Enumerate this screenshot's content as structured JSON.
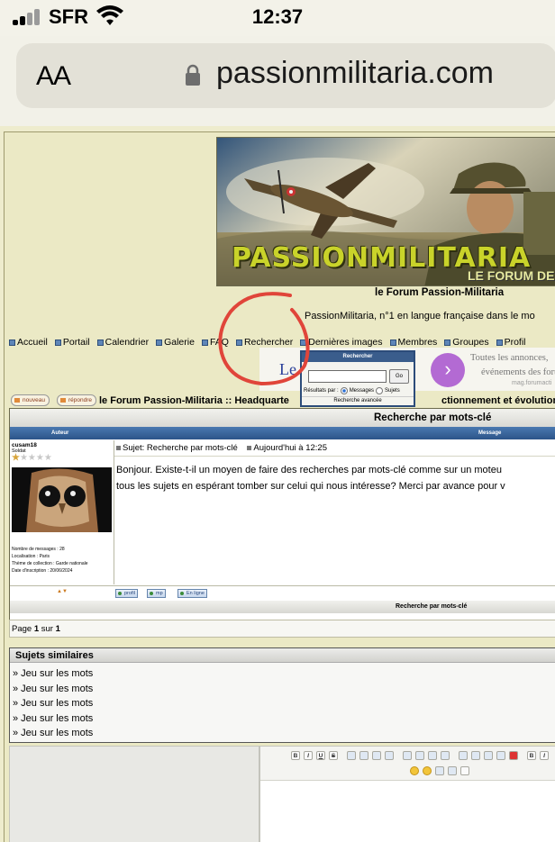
{
  "status_bar": {
    "carrier": "SFR",
    "time": "12:37"
  },
  "browser": {
    "aa_label": "AA",
    "url": "passionmilitaria.com"
  },
  "site": {
    "banner_logo": "PASSIONMILITARIA",
    "banner_sub": "LE FORUM DES",
    "title": "le Forum Passion-Militaria",
    "description": "PassionMilitaria, n°1 en langue française dans le mo"
  },
  "nav": [
    {
      "label": "Accueil"
    },
    {
      "label": "Portail"
    },
    {
      "label": "Calendrier"
    },
    {
      "label": "Galerie"
    },
    {
      "label": "FAQ"
    },
    {
      "label": "Rechercher"
    },
    {
      "label": "Dernières images"
    },
    {
      "label": "Membres"
    },
    {
      "label": "Groupes"
    },
    {
      "label": "Profil"
    }
  ],
  "ad": {
    "le": "Le",
    "line1": "Toutes les annonces,",
    "line2": "événements des forum",
    "source": "mag.forumacti",
    "arrow": "›"
  },
  "search_popup": {
    "header": "Rechercher",
    "input_value": "",
    "go_label": "Go",
    "results_label": "Résultats par :",
    "option_messages": "Messages",
    "option_sujets": "Sujets",
    "selected": "Messages",
    "advanced": "Recherche avancée"
  },
  "actions": {
    "new_label": "nouveau",
    "reply_label": "répondre"
  },
  "breadcrumb": {
    "text": "le Forum Passion-Militaria :: Headquarte",
    "tail": "ctionnement et évolutions d"
  },
  "topic": {
    "title": "Recherche par mots-clé",
    "col_author": "Auteur",
    "col_message": "Message"
  },
  "post": {
    "author": "cusam18",
    "rank": "Soldat",
    "rating": {
      "filled": 1,
      "total": 5
    },
    "info": [
      "Nombre de messages : 28",
      "Localisation : Paris",
      "Thème de collection : Garde nationale",
      "Date d'inscription : 20/06/2024"
    ],
    "subject": "Sujet: Recherche par mots-clé",
    "date": "Aujourd'hui à 12:25",
    "body_line1": "Bonjour. Existe-t-il un moyen de faire des recherches par mots-clé comme sur un moteu",
    "body_line2": "tous les sujets en espérant tomber sur celui qui nous intéresse? Merci par avance pour v",
    "buttons": {
      "profile": "profil",
      "mp": "mp",
      "online": "En ligne"
    },
    "footer_title": "Recherche par mots-clé"
  },
  "pager": {
    "page_word": "Page",
    "current": "1",
    "of_word": "sur",
    "total": "1"
  },
  "similar": {
    "title": "Sujets similaires",
    "items": [
      "» Jeu sur les mots",
      "» Jeu sur les mots",
      "» Jeu sur les mots",
      "» Jeu sur les mots",
      "» Jeu sur les mots"
    ]
  },
  "editor": {
    "bold": "B",
    "italic": "I",
    "underline": "U",
    "strike": "S"
  }
}
